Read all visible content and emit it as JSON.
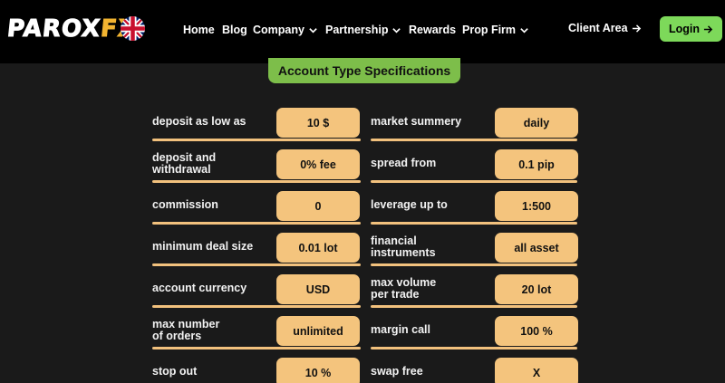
{
  "header": {
    "logo_main": "PAROX",
    "logo_accent": "FX",
    "nav": [
      {
        "label": "Home",
        "dropdown": false
      },
      {
        "label": "Blog",
        "dropdown": false
      },
      {
        "label": "Company",
        "dropdown": true
      },
      {
        "label": "Partnership",
        "dropdown": true
      },
      {
        "label": "Rewards",
        "dropdown": false
      },
      {
        "label": "Prop Firm",
        "dropdown": true
      }
    ],
    "client_area": "Client Area",
    "login": "Login"
  },
  "section_title": "Account Type Specifications",
  "specs_left": [
    {
      "label": "deposit as low as",
      "value": "10 $"
    },
    {
      "label": "deposit and\nwithdrawal",
      "value": "0% fee"
    },
    {
      "label": "commission",
      "value": "0"
    },
    {
      "label": "minimum deal size",
      "value": "0.01 lot"
    },
    {
      "label": "account currency",
      "value": "USD"
    },
    {
      "label": "max number\nof orders",
      "value": "unlimited"
    },
    {
      "label": "stop out",
      "value": "10 %"
    }
  ],
  "specs_right": [
    {
      "label": "market summery",
      "value": "daily"
    },
    {
      "label": "spread from",
      "value": "0.1 pip"
    },
    {
      "label": "leverage up to",
      "value": "1:500"
    },
    {
      "label": "financial\ninstruments",
      "value": "all asset"
    },
    {
      "label": "max volume\nper trade",
      "value": "20 lot"
    },
    {
      "label": "margin call",
      "value": "100 %"
    },
    {
      "label": "swap free",
      "value": "X"
    }
  ],
  "colors": {
    "accent_green": "#7dd95a",
    "title_green": "#7dbe4a",
    "value_peach": "#f4c47d",
    "logo_gold": "#f2b431",
    "background": "#1a1a1a",
    "header_bg": "#000000"
  },
  "icons": {
    "flag": "uk-flag-icon",
    "dropdown": "chevron-down-icon",
    "arrow": "arrow-right-icon"
  }
}
